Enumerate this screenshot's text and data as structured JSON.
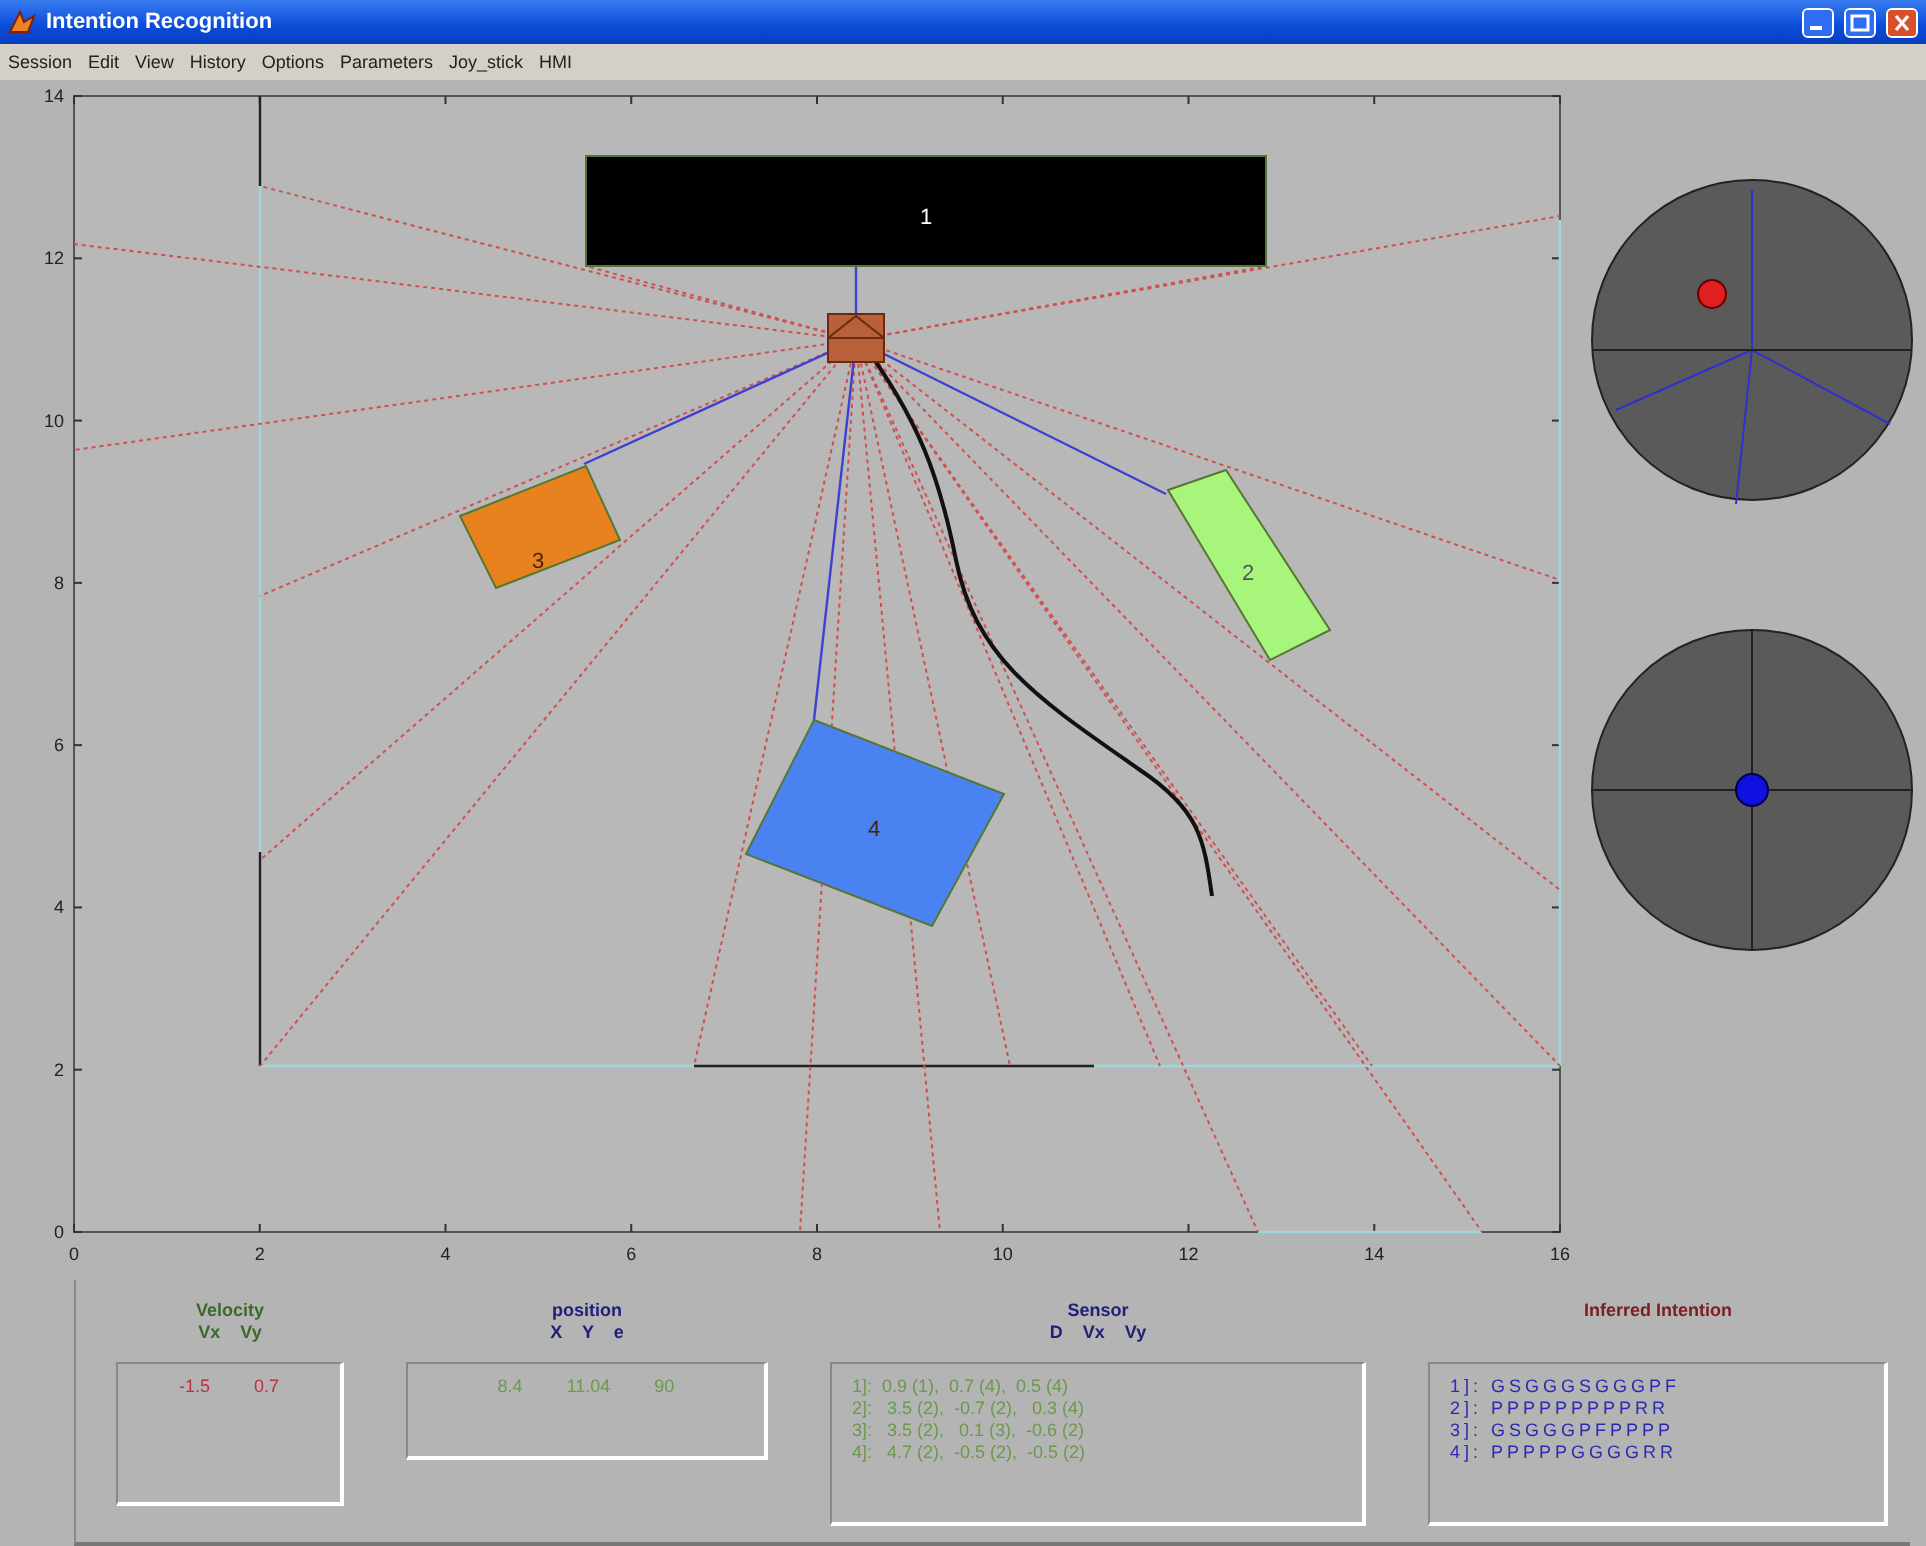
{
  "window": {
    "title": "Intention Recognition"
  },
  "menu": [
    "Session",
    "Edit",
    "View",
    "History",
    "Options",
    "Parameters",
    "Joy_stick",
    "HMI"
  ],
  "plot": {
    "xticks": [
      "0",
      "2",
      "4",
      "6",
      "8",
      "10",
      "12",
      "14",
      "16"
    ],
    "yticks": [
      "14",
      "12",
      "10",
      "8",
      "6",
      "4",
      "2",
      "0"
    ],
    "objects": [
      {
        "label": "1",
        "color": "#000000"
      },
      {
        "label": "2",
        "color": "#a8f57c"
      },
      {
        "label": "3",
        "color": "#e8821e"
      },
      {
        "label": "4",
        "color": "#4a82f2"
      }
    ]
  },
  "velocity": {
    "title": "Velocity",
    "columns": "Vx    Vy",
    "values": [
      "-1.5",
      "0.7"
    ]
  },
  "position": {
    "title": "position",
    "columns": "X    Y    e",
    "values": [
      "8.4",
      "11.04",
      "90"
    ]
  },
  "sensor": {
    "title": "Sensor",
    "columns": "D    Vx    Vy",
    "rows": [
      "1]:  0.9 (1),  0.7 (4),  0.5 (4)",
      "2]:   3.5 (2),  -0.7 (2),   0.3 (4)",
      "3]:   3.5 (2),   0.1 (3),  -0.6 (2)",
      "4]:   4.7 (2),  -0.5 (2),  -0.5 (2)"
    ]
  },
  "intention": {
    "title": "Inferred Intention",
    "rows": [
      "1]: GSGGGSGGGPF",
      "2]: PPPPPPPPPRR",
      "3]: GSGGGPFPPPP",
      "4]: PPPPPGGGGRR"
    ]
  }
}
